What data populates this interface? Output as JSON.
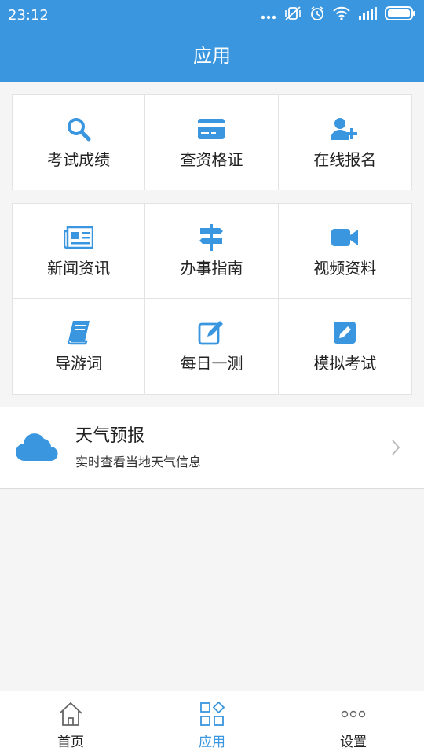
{
  "status_bar": {
    "time": "23:12"
  },
  "header": {
    "title": "应用"
  },
  "grid_top": [
    {
      "label": "考试成绩",
      "icon": "search-icon"
    },
    {
      "label": "查资格证",
      "icon": "card-icon"
    },
    {
      "label": "在线报名",
      "icon": "add-user-icon"
    }
  ],
  "grid_bottom": [
    {
      "label": "新闻资讯",
      "icon": "newspaper-icon"
    },
    {
      "label": "办事指南",
      "icon": "signpost-icon"
    },
    {
      "label": "视频资料",
      "icon": "video-camera-icon"
    },
    {
      "label": "导游词",
      "icon": "book-icon"
    },
    {
      "label": "每日一测",
      "icon": "edit-icon"
    },
    {
      "label": "模拟考试",
      "icon": "pencil-square-icon"
    }
  ],
  "weather": {
    "title": "天气预报",
    "subtitle": "实时查看当地天气信息",
    "icon": "cloud-icon"
  },
  "bottom_nav": [
    {
      "label": "首页",
      "icon": "home-icon",
      "active": false
    },
    {
      "label": "应用",
      "icon": "apps-icon",
      "active": true
    },
    {
      "label": "设置",
      "icon": "more-dots-icon",
      "active": false
    }
  ],
  "colors": {
    "primary": "#3a96de",
    "background": "#f4f5f4",
    "text": "#222222"
  }
}
